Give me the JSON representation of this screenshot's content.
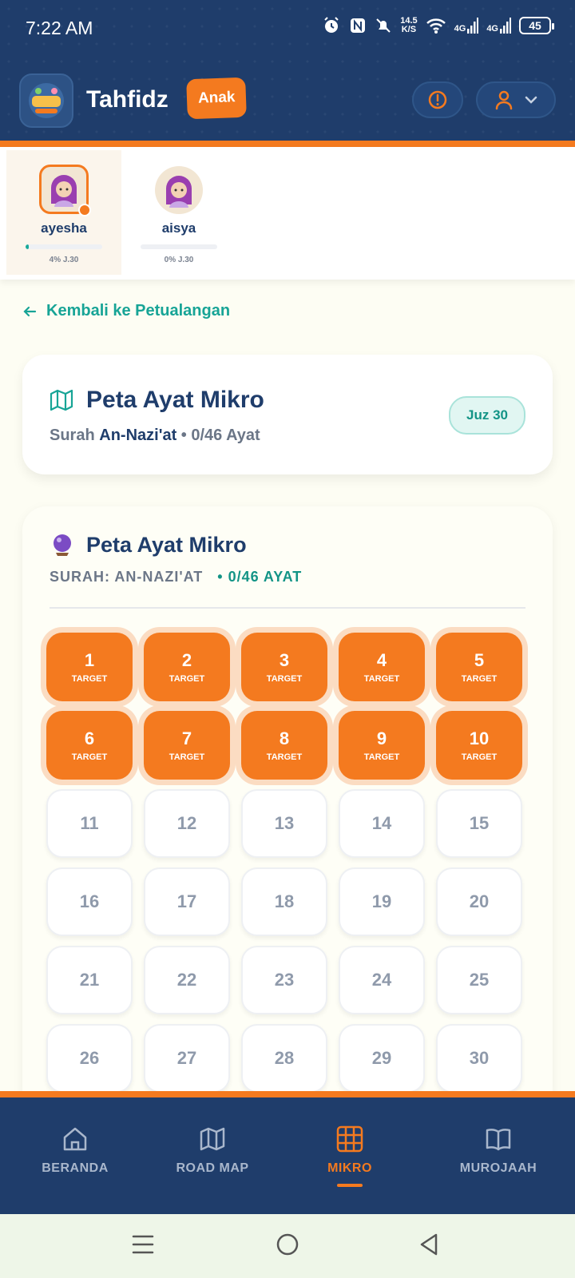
{
  "status_bar": {
    "time": "7:22 AM",
    "net_speed_top": "14.5",
    "net_speed_bottom": "K/S",
    "net1": "4G",
    "net2": "4G",
    "battery": "45"
  },
  "header": {
    "title": "Tahfidz",
    "badge": "Anak"
  },
  "children": [
    {
      "name": "ayesha",
      "progress_label": "4% J.30",
      "progress": 0.04,
      "active": true
    },
    {
      "name": "aisya",
      "progress_label": "0% J.30",
      "progress": 0.0,
      "active": false
    }
  ],
  "back_link": "Kembali ke Petualangan",
  "info_card": {
    "title": "Peta Ayat Mikro",
    "surah_prefix": "Surah",
    "surah_name": "An-Nazi'at",
    "progress": "• 0/46 Ayat",
    "juz": "Juz 30"
  },
  "map_card": {
    "title": "Peta Ayat Mikro",
    "surah": "SURAH: AN-NAZI'AT",
    "progress": "• 0/46 AYAT"
  },
  "verses": [
    {
      "n": "1",
      "label": "TARGET"
    },
    {
      "n": "2",
      "label": "TARGET"
    },
    {
      "n": "3",
      "label": "TARGET"
    },
    {
      "n": "4",
      "label": "TARGET"
    },
    {
      "n": "5",
      "label": "TARGET"
    },
    {
      "n": "6",
      "label": "TARGET"
    },
    {
      "n": "7",
      "label": "TARGET"
    },
    {
      "n": "8",
      "label": "TARGET"
    },
    {
      "n": "9",
      "label": "TARGET"
    },
    {
      "n": "10",
      "label": "TARGET"
    },
    {
      "n": "11"
    },
    {
      "n": "12"
    },
    {
      "n": "13"
    },
    {
      "n": "14"
    },
    {
      "n": "15"
    },
    {
      "n": "16"
    },
    {
      "n": "17"
    },
    {
      "n": "18"
    },
    {
      "n": "19"
    },
    {
      "n": "20"
    },
    {
      "n": "21"
    },
    {
      "n": "22"
    },
    {
      "n": "23"
    },
    {
      "n": "24"
    },
    {
      "n": "25"
    },
    {
      "n": "26"
    },
    {
      "n": "27"
    },
    {
      "n": "28"
    },
    {
      "n": "29"
    },
    {
      "n": "30"
    }
  ],
  "nav": [
    {
      "label": "BERANDA",
      "icon": "home-icon",
      "active": false
    },
    {
      "label": "ROAD MAP",
      "icon": "map-icon",
      "active": false
    },
    {
      "label": "MIKRO",
      "icon": "grid-icon",
      "active": true
    },
    {
      "label": "MUROJAAH",
      "icon": "book-icon",
      "active": false
    }
  ],
  "colors": {
    "primary": "#1f3d6b",
    "accent": "#f47a1f",
    "teal": "#17a496"
  }
}
